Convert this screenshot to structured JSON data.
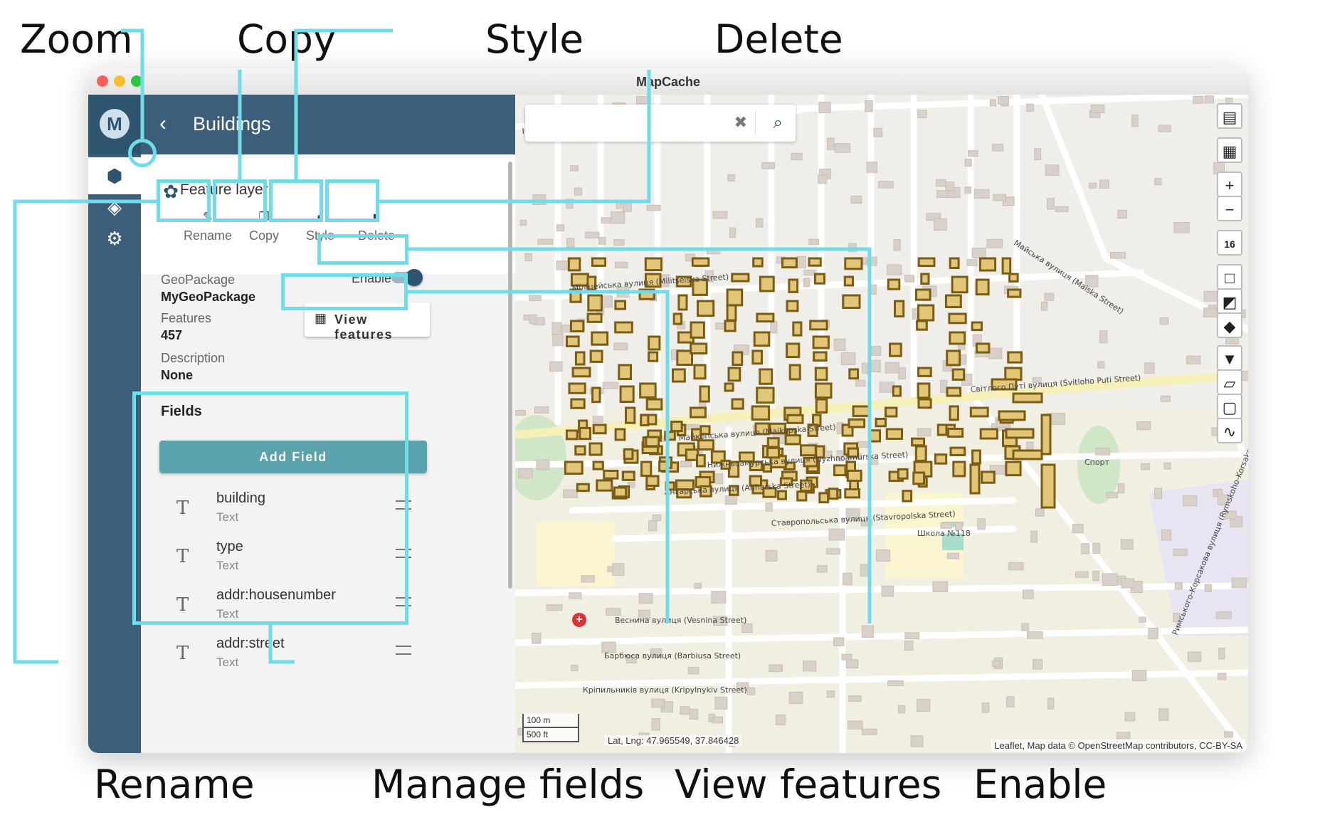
{
  "callouts": {
    "zoom": "Zoom",
    "copy": "Copy",
    "style": "Style",
    "delete": "Delete",
    "rename": "Rename",
    "manage_fields": "Manage fields",
    "view_features": "View features",
    "enable": "Enable"
  },
  "window": {
    "title": "MapCache",
    "traffic_colors": [
      "#fe5f57",
      "#febc2e",
      "#28c840"
    ]
  },
  "rail": {
    "logo": "M",
    "items": [
      {
        "icon": "cube-icon",
        "active": true
      },
      {
        "icon": "layers-icon",
        "active": false
      },
      {
        "icon": "gear-icon",
        "active": false
      }
    ]
  },
  "panel": {
    "back_icon": "chevron-left-icon",
    "title": "Buildings",
    "layer_type": "Feature layer",
    "actions": {
      "rename": "Rename",
      "copy": "Copy",
      "style": "Style",
      "delete": "Delete"
    },
    "geopackage_label": "GeoPackage",
    "geopackage_value": "MyGeoPackage",
    "features_label": "Features",
    "features_value": "457",
    "description_label": "Description",
    "description_value": "None",
    "enable_label": "Enable",
    "enabled": true,
    "view_features_label": "View features",
    "fields_title": "Fields",
    "add_field_label": "Add Field",
    "fields": [
      {
        "name": "building",
        "type": "Text"
      },
      {
        "name": "type",
        "type": "Text"
      },
      {
        "name": "addr:housenumber",
        "type": "Text"
      },
      {
        "name": "addr:street",
        "type": "Text"
      }
    ]
  },
  "map": {
    "zoom_level": "16",
    "scale_metric": "100 m",
    "scale_imperial": "500 ft",
    "latlng": "Lat, Lng: 47.965549, 37.846428",
    "attribution": "Leaflet, Map data © OpenStreetMap contributors, CC-BY-SA",
    "street_labels": [
      "Іркутська вулиця (Irkutska Street)",
      "Міліцейська вулиця (Militseiska Street)",
      "Світлого Путі вулиця (Svitloho Puti Street)",
      "Майкопська вулиця (Maikopska Street)",
      "Нижньоамурська вулиця (Nyzhnoamurska Street)",
      "Ангарська вулиця (Anharska Street)",
      "Ставропольська вулиця (Stavropolska Street)",
      "Веснина вулиця (Vesnina Street)",
      "Барбюса вулиця (Barbiusa Street)",
      "Кріпильників вулиця (Kripylnykiv Street)",
      "Майська вулиця (Maiska Street)",
      "Римського-Корсакова вулиця (Rymskoho-Korsakova Street)",
      "Школа №118",
      "Спорт"
    ],
    "colors": {
      "building_fill": "#e3c779",
      "building_stroke": "#7a5c14",
      "highlight": "#6fdde9"
    }
  }
}
